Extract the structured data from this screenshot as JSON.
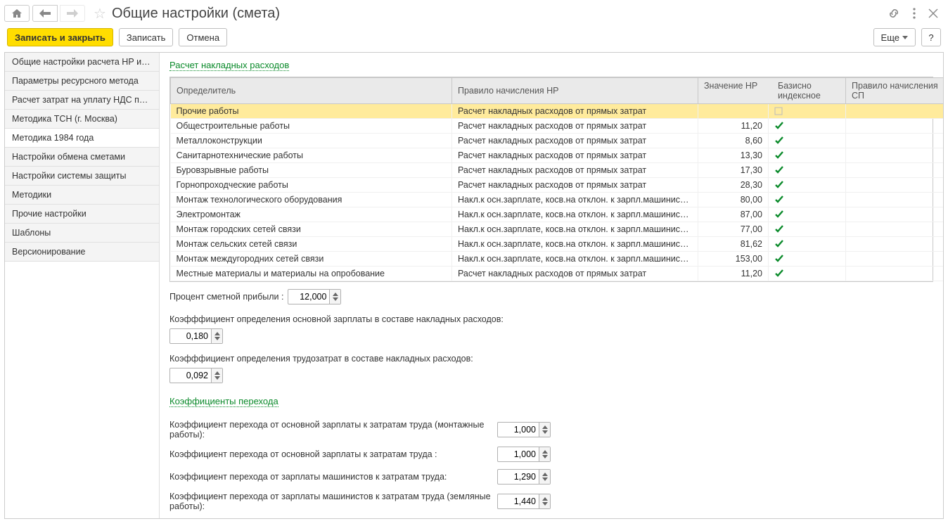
{
  "header": {
    "title": "Общие настройки (смета)"
  },
  "toolbar": {
    "save_close": "Записать и закрыть",
    "save": "Записать",
    "cancel": "Отмена",
    "more": "Еще",
    "help": "?"
  },
  "sidebar": {
    "items": [
      "Общие настройки расчета НР и СП",
      "Параметры ресурсного метода",
      "Расчет затрат на уплату НДС при УСН",
      "Методика ТСН (г. Москва)",
      "Методика 1984 года",
      "Настройки обмена сметами",
      "Настройки системы защиты",
      "Методики",
      "Прочие настройки",
      "Шаблоны",
      "Версионирование"
    ],
    "active_index": 4
  },
  "section1_title": "Расчет накладных расходов",
  "table": {
    "headers": {
      "c0": "Определитель",
      "c1": "Правило начисления НР",
      "c2": "Значение НР",
      "c3": "Базисно индексное",
      "c4": "Правило начисления СП"
    },
    "rows": [
      {
        "n": "Прочие работы",
        "r": "Расчет накладных расходов от прямых затрат",
        "v": "",
        "b": false
      },
      {
        "n": "Общестроительные работы",
        "r": "Расчет накладных расходов от прямых затрат",
        "v": "11,20",
        "b": true
      },
      {
        "n": "Металлоконструкции",
        "r": "Расчет накладных расходов от прямых затрат",
        "v": "8,60",
        "b": true
      },
      {
        "n": "Санитарнотехнические работы",
        "r": "Расчет накладных расходов от прямых затрат",
        "v": "13,30",
        "b": true
      },
      {
        "n": "Буровзрывные работы",
        "r": "Расчет накладных расходов от прямых затрат",
        "v": "17,30",
        "b": true
      },
      {
        "n": "Горнопроходческие работы",
        "r": "Расчет накладных расходов от прямых затрат",
        "v": "28,30",
        "b": true
      },
      {
        "n": "Монтаж технологического оборудования",
        "r": "Накл.к осн.зарплате, косв.на отклон. к зарпл.машинистов",
        "v": "80,00",
        "b": true
      },
      {
        "n": "Электромонтаж",
        "r": "Накл.к осн.зарплате, косв.на отклон. к зарпл.машинистов",
        "v": "87,00",
        "b": true
      },
      {
        "n": "Монтаж городских сетей связи",
        "r": "Накл.к осн.зарплате, косв.на отклон. к зарпл.машинистов",
        "v": "77,00",
        "b": true
      },
      {
        "n": "Монтаж сельских сетей связи",
        "r": "Накл.к осн.зарплате, косв.на отклон. к зарпл.машинистов",
        "v": "81,62",
        "b": true
      },
      {
        "n": "Монтаж междугородних сетей связи",
        "r": "Накл.к осн.зарплате, косв.на отклон. к зарпл.машинистов",
        "v": "153,00",
        "b": true
      },
      {
        "n": "Местные материалы и материалы на опробование",
        "r": "Расчет накладных расходов от прямых затрат",
        "v": "11,20",
        "b": true
      }
    ]
  },
  "fields": {
    "profit_pct_label": "Процент сметной прибыли :",
    "profit_pct": "12,000",
    "k_osn_zp_label": "Коэфффициент определения основной зарплаты в составе накладных расходов:",
    "k_osn_zp": "0,180",
    "k_trud_label": "Коэфффициент определения трудозатрат в составе накладных расходов:",
    "k_trud": "0,092"
  },
  "section2_title": "Коэффициенты перехода",
  "coefs": {
    "c1_label": "Коэффициент перехода от основной зарплаты к затратам труда (монтажные работы):",
    "c1_val": "1,000",
    "c2_label": "Коэффициент перехода от основной зарплаты к затратам труда :",
    "c2_val": "1,000",
    "c3_label": "Коэффициент  перехода от зарплаты машинистов к затратам труда:",
    "c3_val": "1,290",
    "c4_label": "Коэффициент  перехода от зарплаты машинистов к затратам труда (земляные работы):",
    "c4_val": "1,440"
  }
}
